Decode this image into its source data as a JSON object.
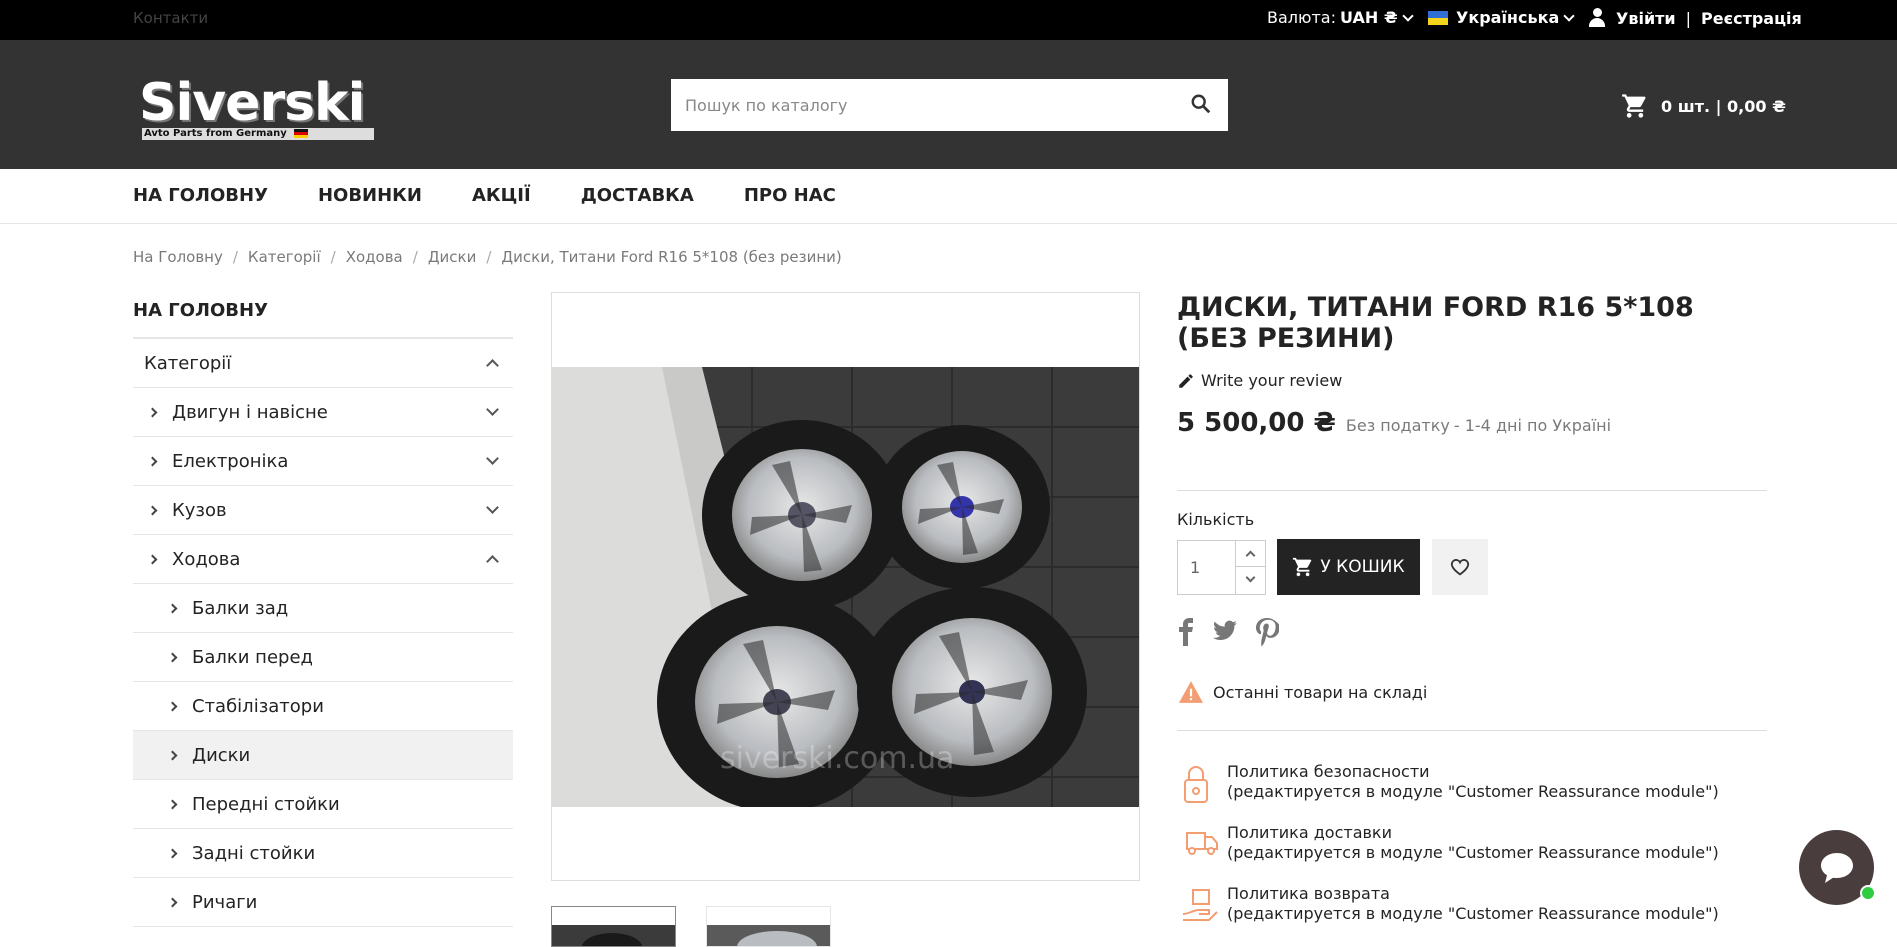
{
  "topbar": {
    "contacts": "Контакти",
    "currency_label": "Валюта:",
    "currency_value": "UAH ₴",
    "language": "Українська",
    "login": "Увійти",
    "separator": "|",
    "register": "Реєстрація"
  },
  "header": {
    "logo_text": "Siverski",
    "logo_tagline": "Avto Parts from Germany",
    "search_placeholder": "Пошук по каталогу",
    "cart_summary": "0 шт. | 0,00 ₴"
  },
  "nav": {
    "items": [
      "НА ГОЛОВНУ",
      "НОВИНКИ",
      "АКЦІЇ",
      "ДОСТАВКА",
      "ПРО НАС"
    ]
  },
  "breadcrumb": [
    "На Головну",
    "Категорії",
    "Ходова",
    "Диски",
    "Диски, Титани Ford R16 5*108 (без резини)"
  ],
  "sidebar": {
    "home": "НА ГОЛОВНУ",
    "categories": "Категорії",
    "level1": [
      "Двигун і навісне",
      "Електроніка",
      "Кузов",
      "Ходова"
    ],
    "level2": [
      "Балки зад",
      "Балки перед",
      "Стабілізатори",
      "Диски",
      "Передні стойки",
      "Задні стойки",
      "Ричаги"
    ],
    "active": "Диски"
  },
  "product": {
    "title": "Диски, Титани Ford R16 5*108 (без резини)",
    "review": "Write your review",
    "price": "5 500,00 ₴",
    "tax_note": "Без податку",
    "delivery_note": " - 1-4 дні по Україні",
    "quantity_label": "Кількість",
    "quantity_value": "1",
    "add_to_cart": "У КОШИК",
    "stock_note": "Останні товари на складі",
    "watermark": "siverski.com.ua"
  },
  "reassurance": [
    {
      "title": "Политика безопасности",
      "note": "(редактируется в модуле \"Customer Reassurance module\")"
    },
    {
      "title": "Политика доставки",
      "note": "(редактируется в модуле \"Customer Reassurance module\")"
    },
    {
      "title": "Политика возврата",
      "note": "(редактируется в модуле \"Customer Reassurance module\")"
    }
  ],
  "colors": {
    "topbar": "#000000",
    "header": "#333333",
    "button": "#232323",
    "warning": "#f39d72",
    "chat": "#4a3d3d"
  }
}
